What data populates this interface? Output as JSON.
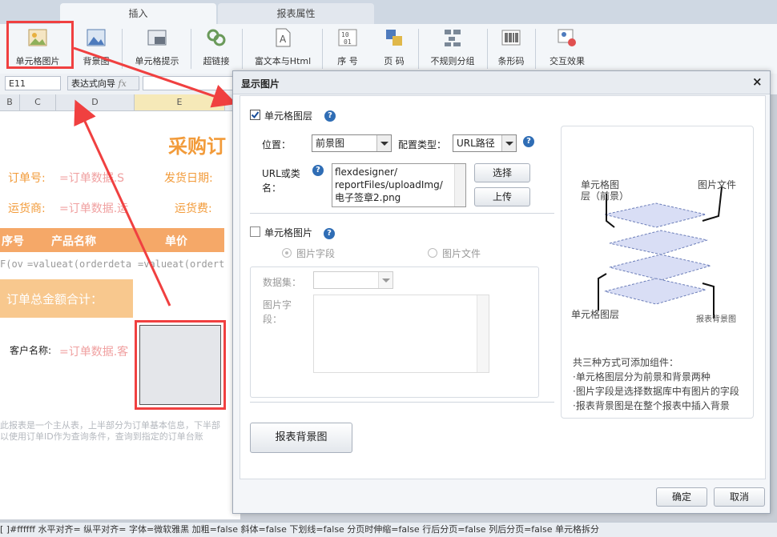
{
  "ribbon": {
    "tabs": [
      "插入",
      "报表属性"
    ],
    "tools": [
      {
        "label": "单元格图片",
        "icon": "image-icon"
      },
      {
        "label": "背景图",
        "icon": "background-image-icon"
      },
      {
        "label": "单元格提示",
        "icon": "cell-tooltip-icon"
      },
      {
        "label": "超链接",
        "icon": "hyperlink-icon"
      },
      {
        "label": "富文本与Html",
        "icon": "rich-text-icon"
      },
      {
        "label": "序 号",
        "icon": "sequence-number-icon"
      },
      {
        "label": "页 码",
        "icon": "page-number-icon"
      },
      {
        "label": "不规则分组",
        "icon": "irregular-group-icon"
      },
      {
        "label": "条形码",
        "icon": "barcode-icon"
      },
      {
        "label": "交互效果",
        "icon": "interaction-icon"
      }
    ]
  },
  "formula_bar": {
    "cell_ref": "E11",
    "wizard_label": "表达式向导",
    "fx": "fx"
  },
  "sheet": {
    "columns": [
      "B",
      "C",
      "D",
      "E"
    ],
    "title": "采购订",
    "order_no_label": "订单号:",
    "order_no_value": "=订单数据.S",
    "ship_date_label": "发货日期:",
    "shipper_label": "运货商:",
    "shipper_value": "=订单数据.运",
    "freight_label": "运货费:",
    "header_no": "序号",
    "header_product": "产品名称",
    "header_price": "单价",
    "row_formula_1": "F(ov",
    "row_formula_2": "=valueat(orderdeta",
    "row_formula_3": "=valueat(ordert",
    "total_label": "订单总金额合计：",
    "customer_label": "客户名称:",
    "customer_value": "=订单数据.客",
    "note_line1": "此报表是一个主从表，上半部分为订单基本信息，下半部",
    "note_line2": "以使用订单ID作为查询条件，查询到指定的订单台账"
  },
  "status_bar": {
    "text": "[ ]#ffffff 水平对齐= 纵平对齐= 字体=微软雅黑 加粗=false 斜体=false 下划线=false 分页时伸缩=false 行后分页=false 列后分页=false 单元格拆分"
  },
  "dialog": {
    "title": "显示图片",
    "close": "×",
    "cell_layer": {
      "label": "单元格图层",
      "checked": true,
      "position_label": "位置：",
      "position_value": "前景图",
      "config_type_label": "配置类型：",
      "config_type_value": "URL路径",
      "url_label_line1": "URL或类",
      "url_label_line2": "名：",
      "url_value": "flexdesigner/\nreportFiles/uploadImg/\n电子签章2.png",
      "select_button": "选择",
      "upload_button": "上传"
    },
    "cell_image": {
      "label": "单元格图片",
      "checked": false,
      "radio_field": "图片字段",
      "radio_file": "图片文件",
      "dataset_label": "数据集：",
      "image_field_label_line1": "图片字",
      "image_field_label_line2": "段："
    },
    "diagram": {
      "label_layer_line1": "单元格图",
      "label_layer_line2": "层（前景）",
      "label_file": "图片文件",
      "label_cell_layer": "单元格图层",
      "label_bottom": "报表背景图",
      "info_title": "共三种方式可添加组件：",
      "info_lines": [
        "·单元格图层分为前景和背景两种",
        "·图片字段是选择数据库中有图片的字段",
        "·报表背景图是在整个报表中插入背景"
      ]
    },
    "report_bg_button": "报表背景图",
    "ok_button": "确定",
    "cancel_button": "取消"
  },
  "colors": {
    "accent_red": "#f04040",
    "orange": "#f29b3a",
    "help_blue": "#2f6db5"
  }
}
